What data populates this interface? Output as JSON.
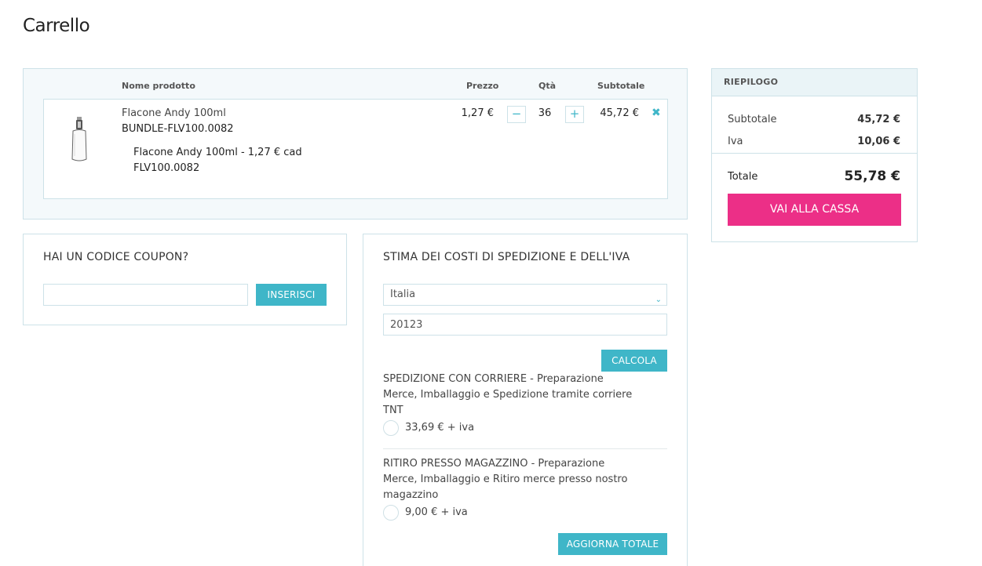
{
  "page": {
    "title": "Carrello"
  },
  "cart": {
    "columns": {
      "name": "Nome prodotto",
      "price": "Prezzo",
      "qty": "Qtà",
      "subtotal": "Subtotale"
    },
    "item": {
      "name": "Flacone Andy 100ml",
      "sku": "BUNDLE-FLV100.0082",
      "bundle_line": "Flacone Andy 100ml - 1,27 € cad",
      "bundle_sku": "FLV100.0082",
      "price": "1,27 €",
      "qty": "36",
      "subtotal": "45,72 €",
      "minus": "−",
      "plus": "+",
      "remove": "✖"
    }
  },
  "coupon": {
    "title": "HAI UN CODICE COUPON?",
    "value": "",
    "button": "INSERISCI"
  },
  "shipping": {
    "title": "STIMA DEI COSTI DI SPEDIZIONE E DELL'IVA",
    "country": "Italia",
    "zip": "20123",
    "calc_button": "CALCOLA",
    "options": [
      {
        "text": "SPEDIZIONE CON CORRIERE - Preparazione Merce, Imballaggio e Spedizione tramite corriere TNT",
        "price": "33,69 € + iva"
      },
      {
        "text": "RITIRO PRESSO MAGAZZINO - Preparazione Merce, Imballaggio e Ritiro merce presso nostro magazzino",
        "price": "9,00 € + iva"
      }
    ],
    "update_button": "AGGIORNA TOTALE"
  },
  "summary": {
    "title": "RIEPILOGO",
    "subtotal_label": "Subtotale",
    "subtotal_value": "45,72 €",
    "tax_label": "Iva",
    "tax_value": "10,06 €",
    "total_label": "Totale",
    "total_value": "55,78 €",
    "checkout_button": "VAI ALLA CASSA"
  },
  "colors": {
    "accent": "#3fb6c8",
    "checkout": "#ec2f87",
    "border": "#cde2e8",
    "cart_bg": "#f4f9fb"
  },
  "icons": {
    "remove": "close-x-icon",
    "select": "chevron-down-icon",
    "product": "perfume-bottle-image"
  }
}
